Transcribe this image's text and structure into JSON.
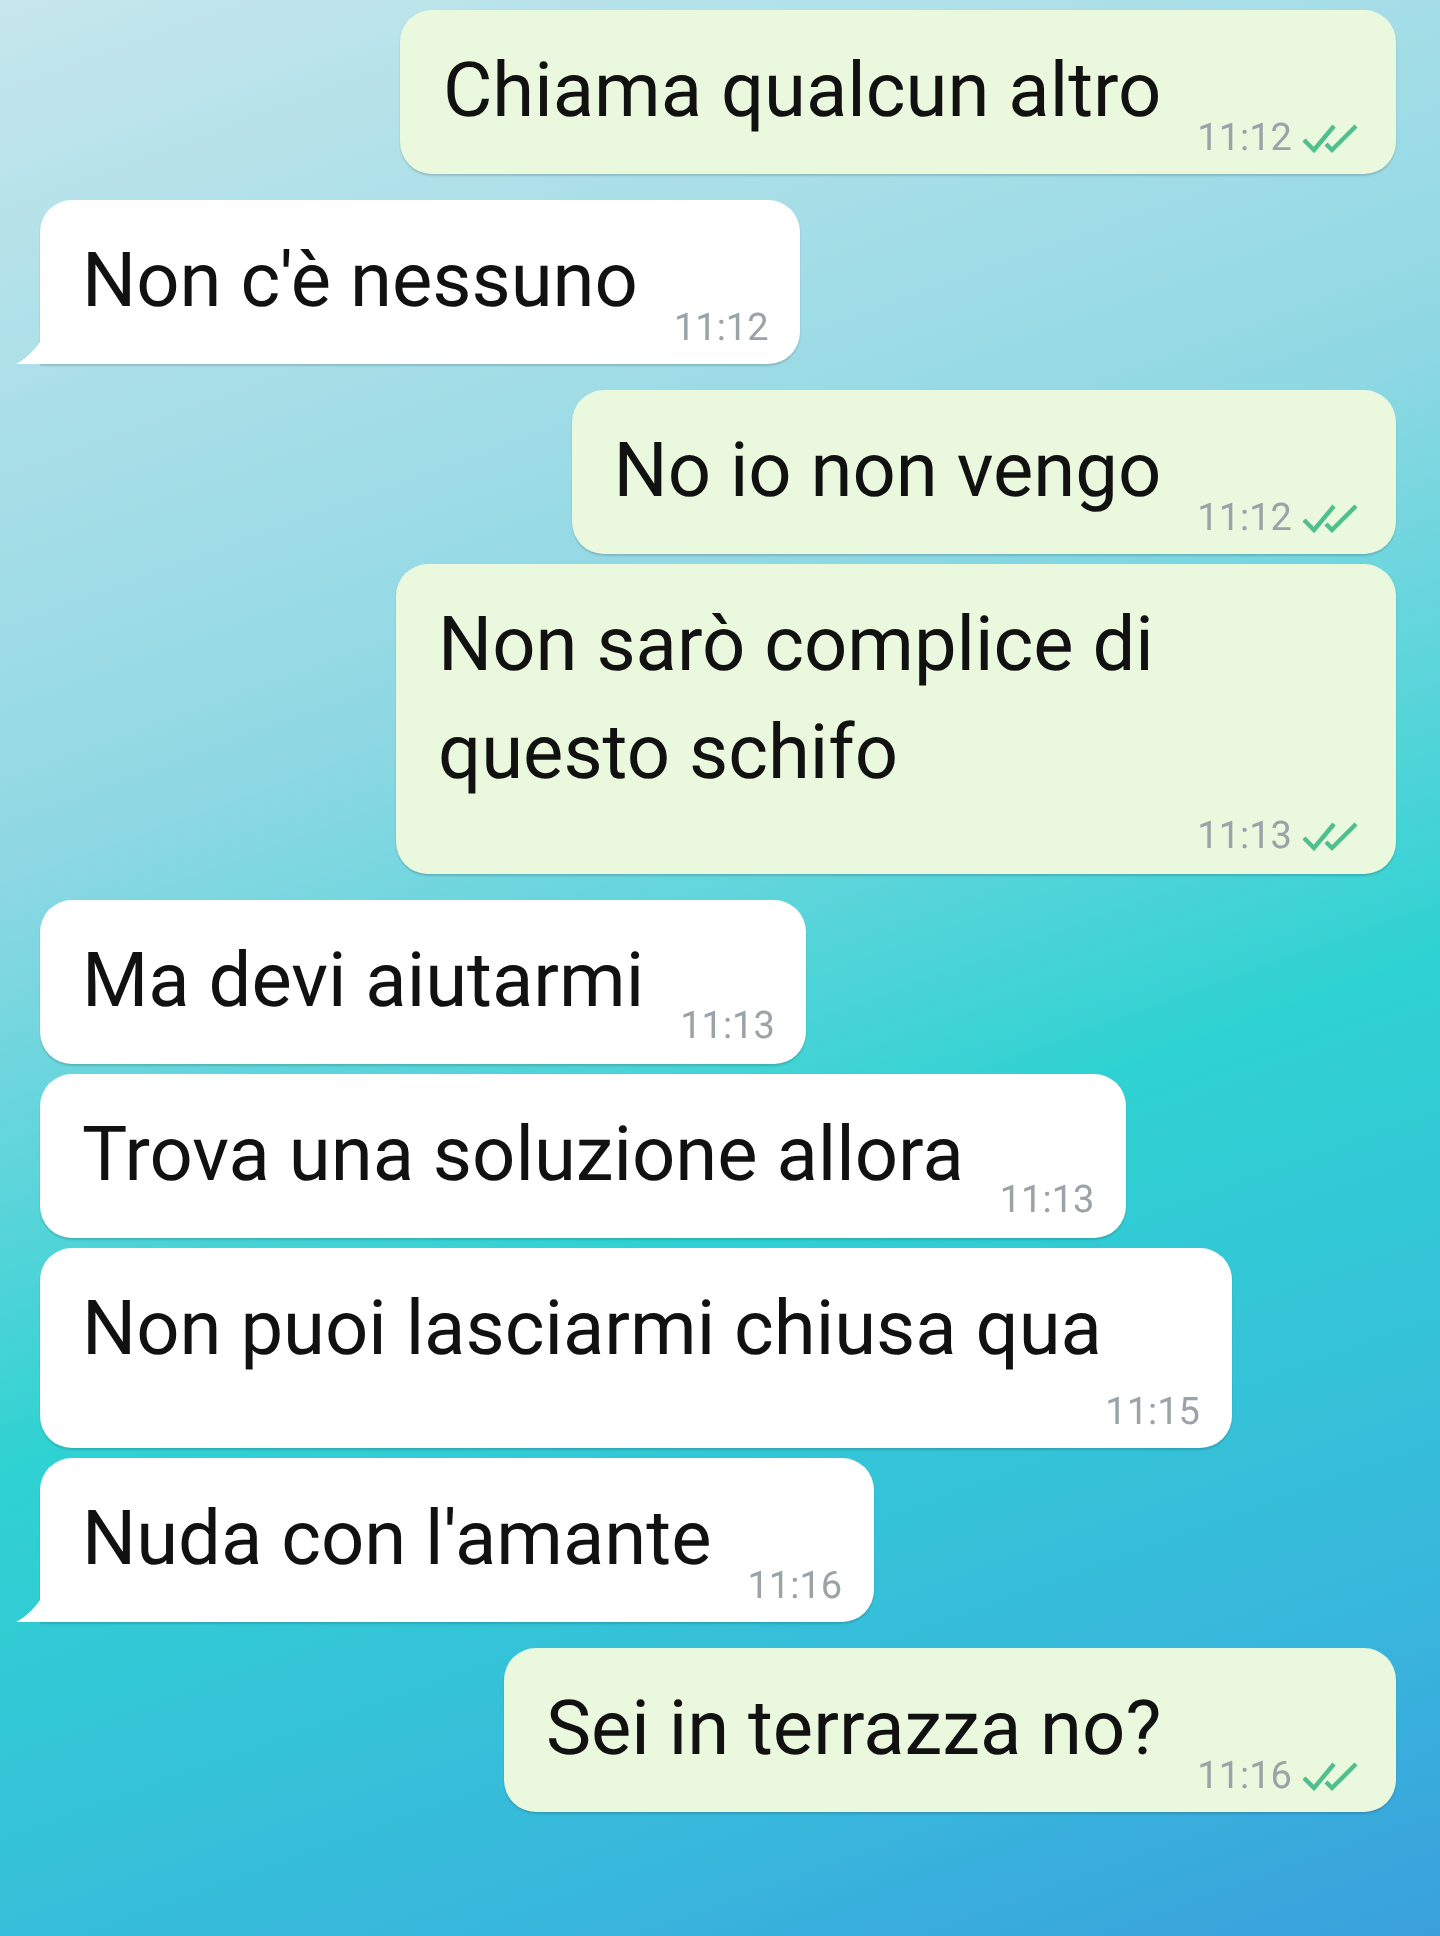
{
  "messages": [
    {
      "kind": "outgoing",
      "text": "Chiama qualcun altro",
      "time": "11:12",
      "read": true,
      "tail": false
    },
    {
      "kind": "incoming",
      "text": "Non c'è nessuno",
      "time": "11:12",
      "tail": true
    },
    {
      "kind": "outgoing",
      "text": "No io non vengo",
      "time": "11:12",
      "read": true,
      "tail": false
    },
    {
      "kind": "outgoing",
      "text": "Non sarò complice di questo schifo",
      "time": "11:13",
      "read": true,
      "tail": false
    },
    {
      "kind": "incoming",
      "text": "Ma devi aiutarmi",
      "time": "11:13",
      "tail": false
    },
    {
      "kind": "incoming",
      "text": "Trova una soluzione allora",
      "time": "11:13",
      "tail": false
    },
    {
      "kind": "incoming",
      "text": "Non puoi lasciarmi chiusa qua",
      "time": "11:15",
      "tail": false
    },
    {
      "kind": "incoming",
      "text": "Nuda con l'amante",
      "time": "11:16",
      "tail": true
    },
    {
      "kind": "outgoing",
      "text": "Sei in terrazza no?",
      "time": "11:16",
      "read": true,
      "tail": false
    }
  ]
}
